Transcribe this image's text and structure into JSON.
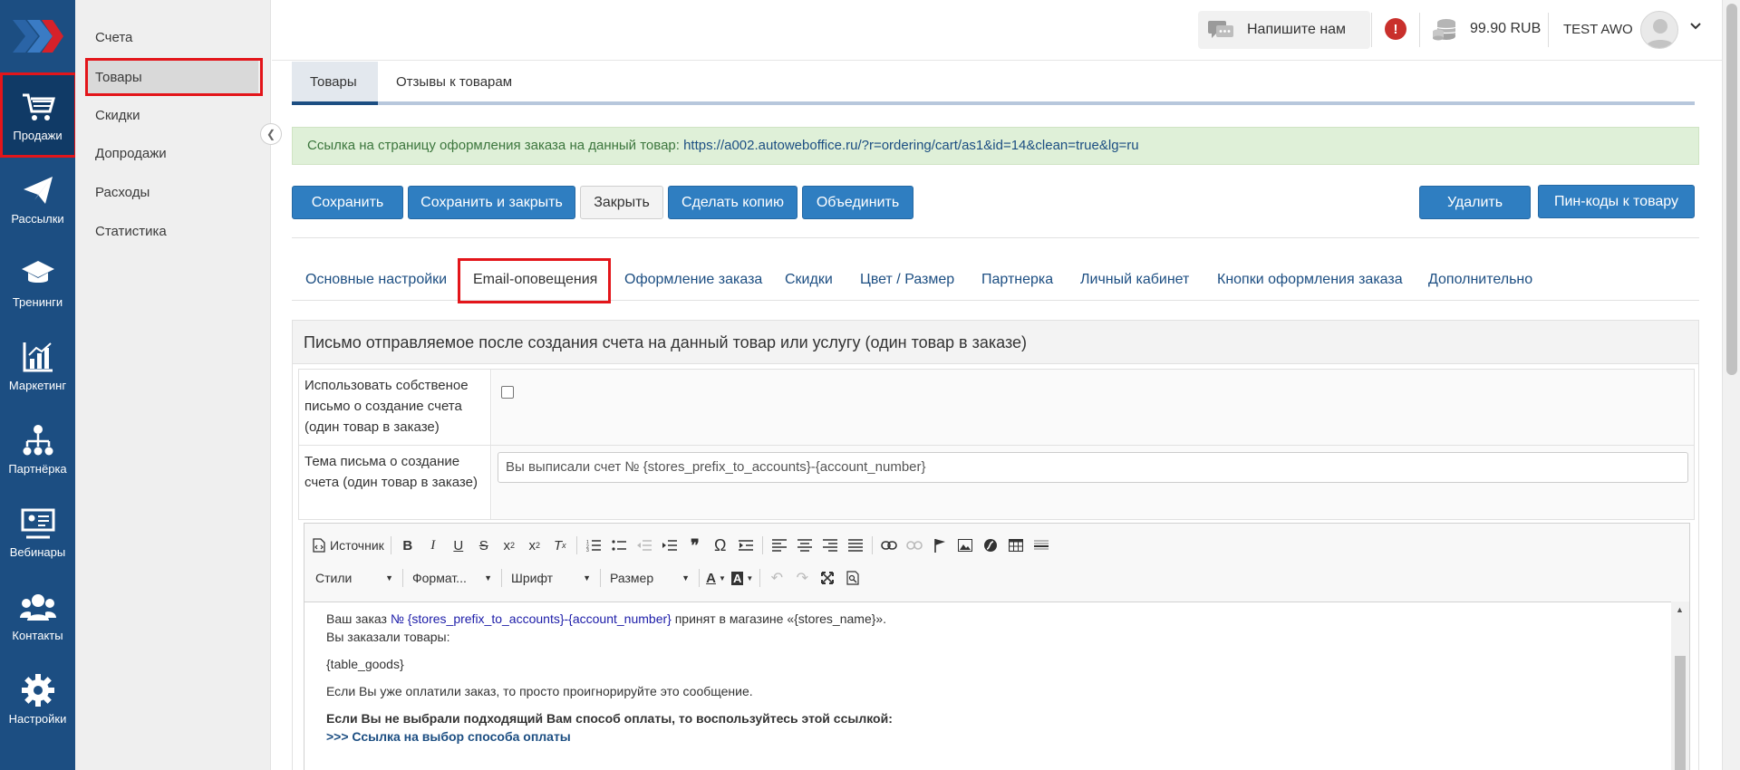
{
  "rail": {
    "items": [
      {
        "label": "Продажи",
        "icon": "cart-icon"
      },
      {
        "label": "Рассылки",
        "icon": "paper-plane-icon"
      },
      {
        "label": "Тренинги",
        "icon": "graduation-cap-icon"
      },
      {
        "label": "Маркетинг",
        "icon": "bar-chart-icon"
      },
      {
        "label": "Партнёрка",
        "icon": "sitemap-icon"
      },
      {
        "label": "Вебинары",
        "icon": "presentation-icon"
      },
      {
        "label": "Контакты",
        "icon": "users-icon"
      },
      {
        "label": "Настройки",
        "icon": "gear-icon"
      }
    ]
  },
  "submenu": {
    "items": [
      "Счета",
      "Товары",
      "Скидки",
      "Допродажи",
      "Расходы",
      "Статистика"
    ]
  },
  "topbar": {
    "chat_label": "Напишите нам",
    "alert_symbol": "!",
    "balance": "99.90 RUB",
    "username": "TEST AWO"
  },
  "page_tabs": [
    "Товары",
    "Отзывы к товарам"
  ],
  "info": {
    "text": "Ссылка на страницу оформления заказа на данный товар:",
    "url": "https://a002.autoweboffice.ru/?r=ordering/cart/as1&id=14&clean=true&lg=ru"
  },
  "buttons": {
    "save": "Сохранить",
    "save_close": "Сохранить и закрыть",
    "close": "Закрыть",
    "copy": "Сделать копию",
    "merge": "Объединить",
    "delete": "Удалить",
    "pins": "Пин-коды к товару"
  },
  "sub_tabs": [
    "Основные настройки",
    "Email-оповещения",
    "Оформление заказа",
    "Скидки",
    "Цвет / Размер",
    "Партнерка",
    "Личный кабинет",
    "Кнопки оформления заказа",
    "Дополнительно"
  ],
  "panel": {
    "title": "Письмо отправляемое после создания счета на данный товар или услугу (один товар в заказе)",
    "use_own_label": "Использовать собственое письмо о создание счета (один товар в заказе)",
    "use_own_checked": false,
    "subject_label": "Тема письма о создание счета (один товар в заказе)",
    "subject_value": "Вы выписали счет № {stores_prefix_to_accounts}-{account_number}"
  },
  "editor": {
    "source_label": "Источник",
    "combos": {
      "styles": "Стили",
      "format": "Формат...",
      "font": "Шрифт",
      "size": "Размер"
    },
    "content": {
      "line1_pre": "Ваш заказ ",
      "line1_link": "№ {stores_prefix_to_accounts}-{account_number}",
      "line1_post": " принят в магазине «{stores_name}».",
      "line2": "Вы заказали товары:",
      "line3": "{table_goods}",
      "line4": "Если Вы уже оплатили заказ, то просто проигнорируйте это сообщение.",
      "line5": "Если Вы не выбрали подходящий Вам способ оплаты, то воспользуйтесь этой ссылкой:",
      "line6": ">>> Ссылка на выбор способа оплаты"
    }
  },
  "colors": {
    "rail": "#1c4e82",
    "primary": "#2f7ec1",
    "highlight": "#e3151a",
    "info_bg": "#dff0d8"
  }
}
